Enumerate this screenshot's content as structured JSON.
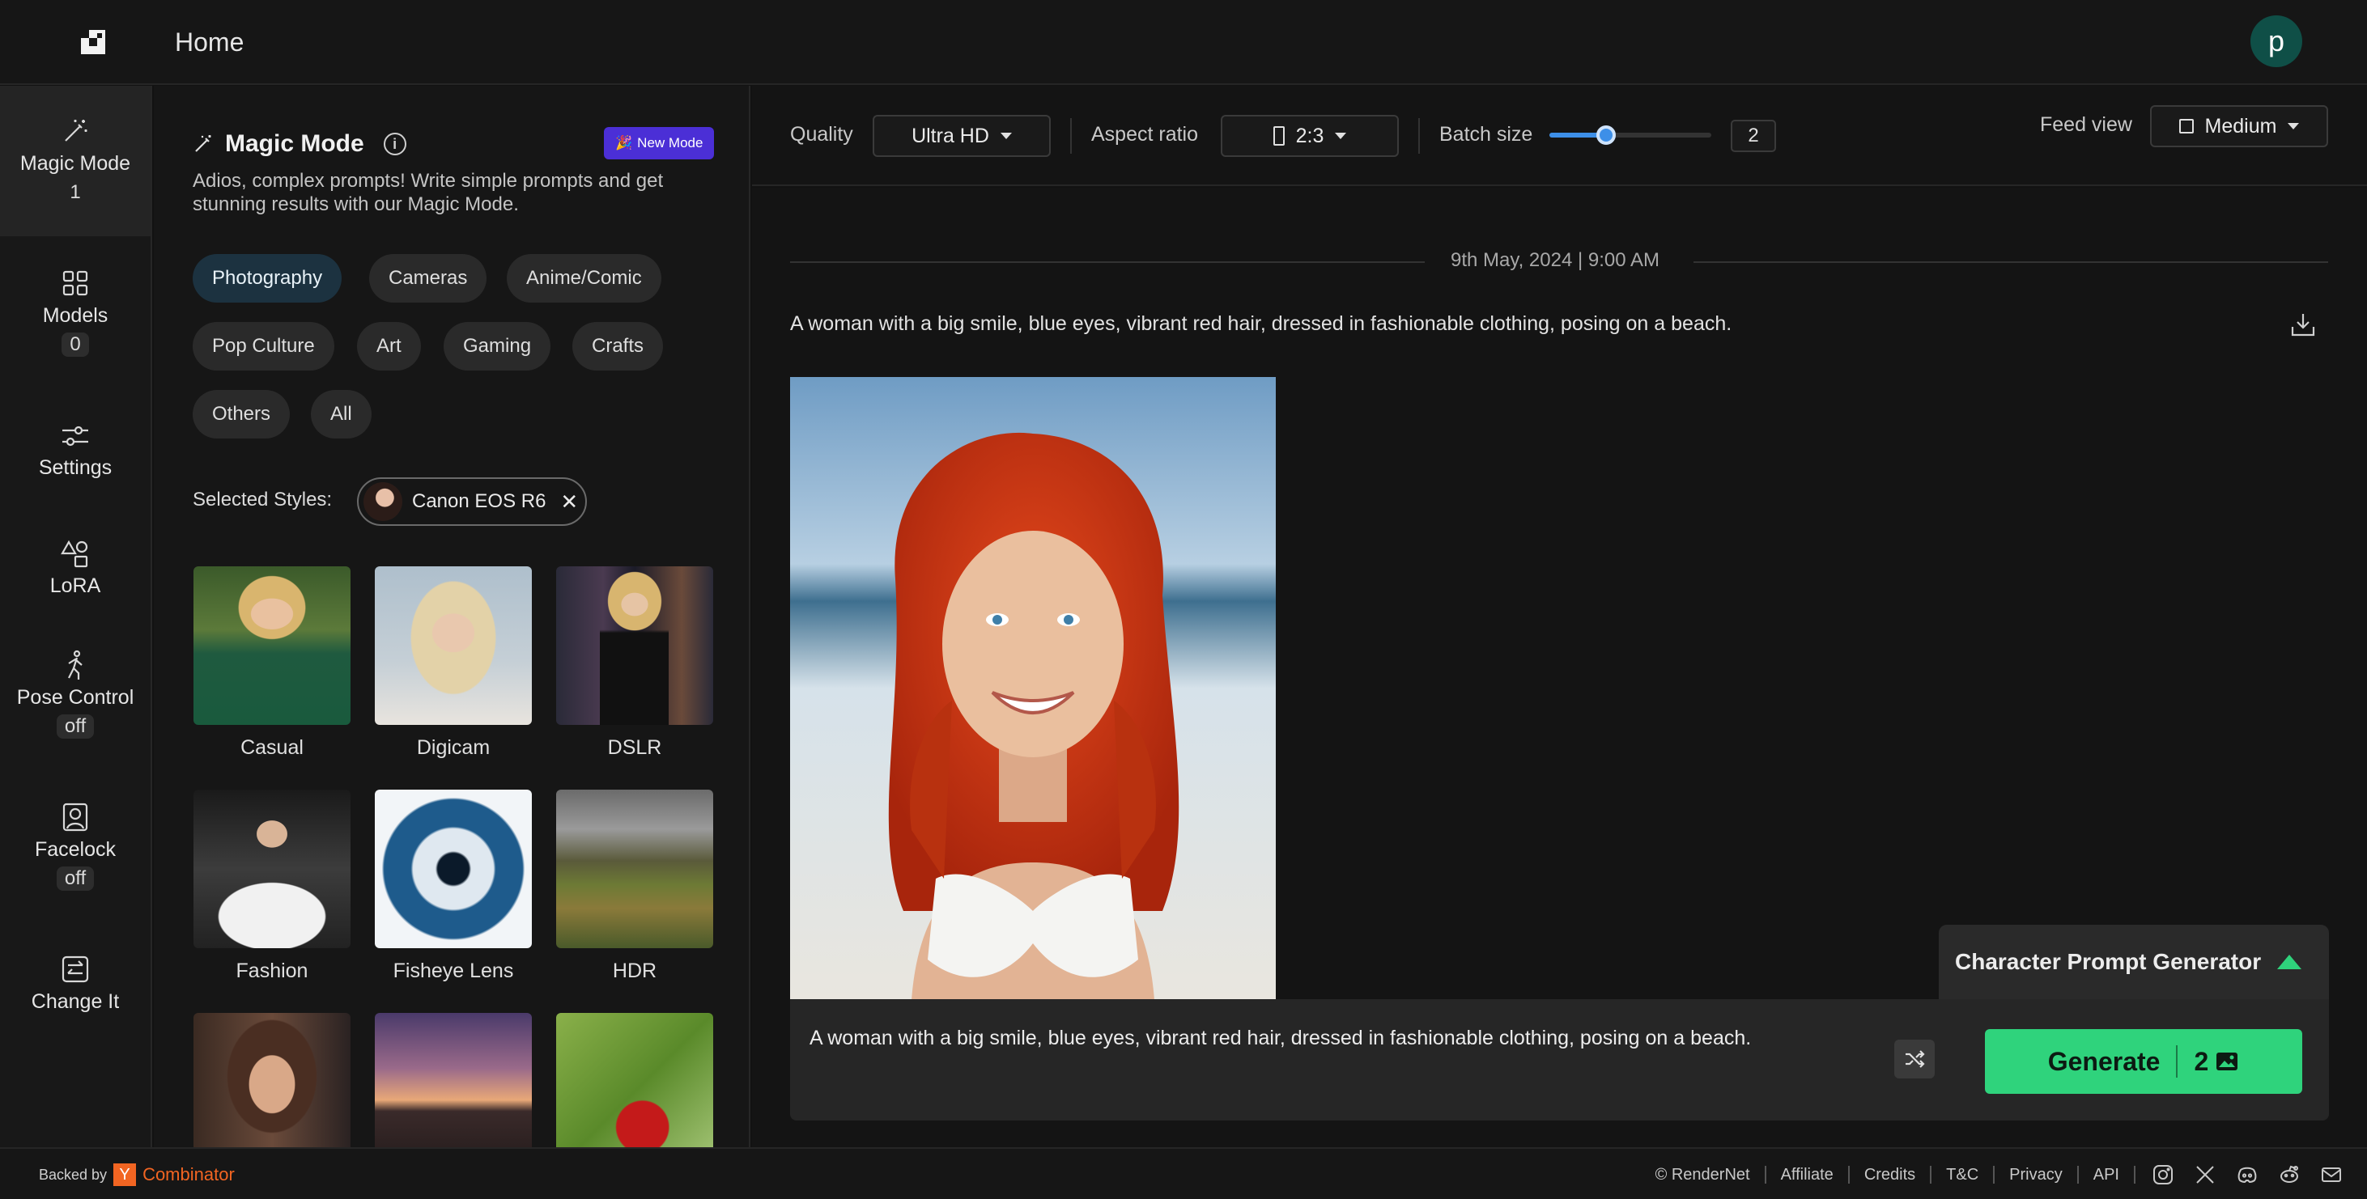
{
  "header": {
    "title": "Home",
    "avatar_letter": "p"
  },
  "rail": {
    "items": [
      {
        "label": "Magic Mode",
        "badge": "1"
      },
      {
        "label": "Models",
        "badge": "0"
      },
      {
        "label": "Settings"
      },
      {
        "label": "LoRA"
      },
      {
        "label": "Pose Control",
        "badge": "off"
      },
      {
        "label": "Facelock",
        "badge": "off"
      },
      {
        "label": "Change It"
      }
    ]
  },
  "magic": {
    "title": "Magic Mode",
    "new_mode": "New Mode",
    "description": "Adios, complex prompts! Write simple prompts and get stunning results with our Magic Mode.",
    "categories": [
      "Photography",
      "Cameras",
      "Anime/Comic",
      "Pop Culture",
      "Art",
      "Gaming",
      "Crafts",
      "Others",
      "All"
    ],
    "selected_label": "Selected Styles:",
    "selected_style": "Canon EOS R6",
    "styles": [
      "Casual",
      "Digicam",
      "DSLR",
      "Fashion",
      "Fisheye Lens",
      "HDR"
    ]
  },
  "toolbar": {
    "quality_label": "Quality",
    "quality_value": "Ultra HD",
    "aspect_label": "Aspect ratio",
    "aspect_value": "2:3",
    "batch_label": "Batch size",
    "batch_value": "2",
    "batch_slider_fraction": 0.35,
    "feed_label": "Feed view",
    "feed_value": "Medium"
  },
  "feed": {
    "date": "9th May, 2024 | 9:00 AM",
    "prompt": "A woman with a big smile, blue eyes, vibrant red hair, dressed in fashionable clothing, posing on a beach."
  },
  "composer": {
    "character_generator": "Character Prompt Generator",
    "prompt": "A woman with a big smile, blue eyes, vibrant red hair, dressed in fashionable clothing, posing on a beach.",
    "generate_label": "Generate",
    "generate_count": "2"
  },
  "footer": {
    "backed_by": "Backed by",
    "yc_letter": "Y",
    "yc_name": "Combinator",
    "links": [
      "© RenderNet",
      "Affiliate",
      "Credits",
      "T&C",
      "Privacy",
      "API"
    ]
  },
  "colors": {
    "accent_green": "#2fd37c",
    "accent_blue": "#3d8fe8",
    "new_mode_purple": "#4b2fd6",
    "yc_orange": "#f26522"
  }
}
